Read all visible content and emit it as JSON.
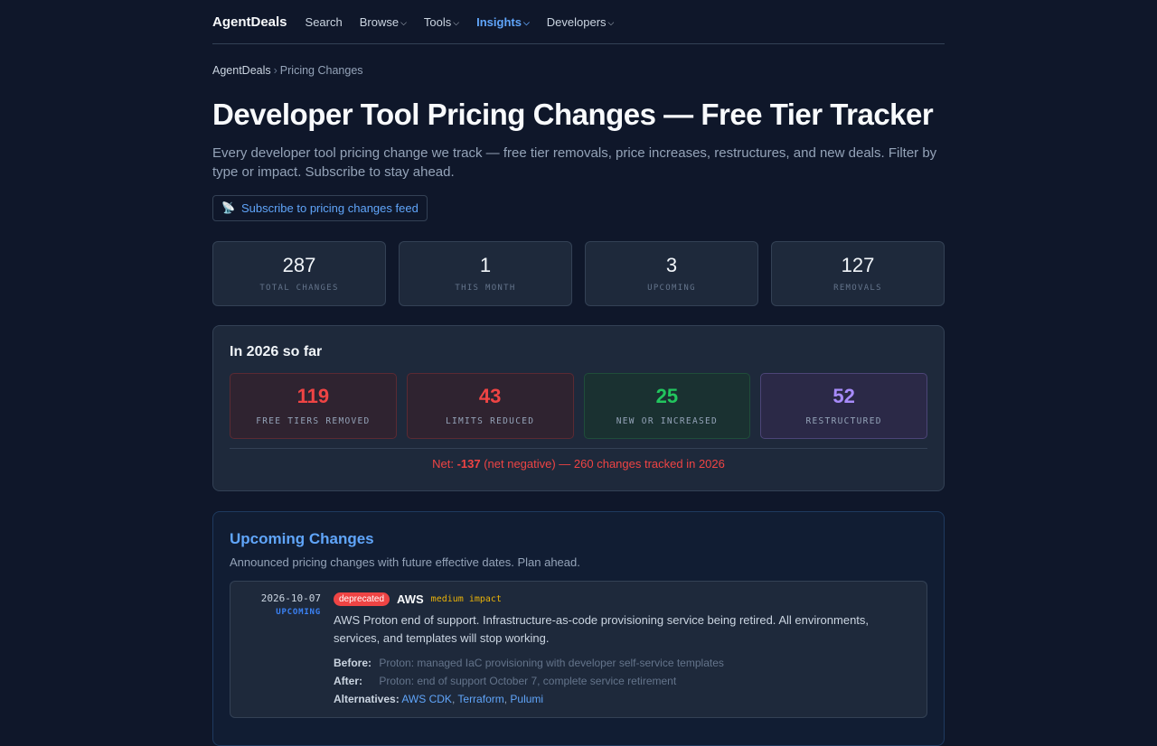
{
  "nav": {
    "brand": "AgentDeals",
    "items": [
      {
        "label": "Search",
        "dropdown": false,
        "active": false
      },
      {
        "label": "Browse",
        "dropdown": true,
        "active": false
      },
      {
        "label": "Tools",
        "dropdown": true,
        "active": false
      },
      {
        "label": "Insights",
        "dropdown": true,
        "active": true
      },
      {
        "label": "Developers",
        "dropdown": true,
        "active": false
      }
    ]
  },
  "breadcrumb": {
    "home": "AgentDeals",
    "separator": "›",
    "current": "Pricing Changes"
  },
  "page": {
    "title": "Developer Tool Pricing Changes — Free Tier Tracker",
    "description": "Every developer tool pricing change we track — free tier removals, price increases, restructures, and new deals. Filter by type or impact. Subscribe to stay ahead.",
    "subscribe_icon": "📡",
    "subscribe_label": "Subscribe to pricing changes feed"
  },
  "stats": [
    {
      "value": "287",
      "label": "TOTAL CHANGES"
    },
    {
      "value": "1",
      "label": "THIS MONTH"
    },
    {
      "value": "3",
      "label": "UPCOMING"
    },
    {
      "value": "127",
      "label": "REMOVALS"
    }
  ],
  "year_summary": {
    "title": "In 2026 so far",
    "cards": [
      {
        "value": "119",
        "label": "FREE TIERS REMOVED",
        "tone": "red"
      },
      {
        "value": "43",
        "label": "LIMITS REDUCED",
        "tone": "red"
      },
      {
        "value": "25",
        "label": "NEW OR INCREASED",
        "tone": "green"
      },
      {
        "value": "52",
        "label": "RESTRUCTURED",
        "tone": "purple"
      }
    ],
    "net_prefix": "Net: ",
    "net_value": "-137",
    "net_suffix": " (net negative) — 260 changes tracked in 2026"
  },
  "upcoming": {
    "title": "Upcoming Changes",
    "subtitle": "Announced pricing changes with future effective dates. Plan ahead.",
    "entries": [
      {
        "date": "2026-10-07",
        "status": "UPCOMING",
        "badge": "deprecated",
        "vendor": "AWS",
        "impact": "medium impact",
        "text": "AWS Proton end of support. Infrastructure-as-code provisioning service being retired. All environments, services, and templates will stop working.",
        "before_label": "Before:",
        "before": "Proton: managed IaC provisioning with developer self-service templates",
        "after_label": "After:",
        "after": "Proton: end of support October 7, complete service retirement",
        "alternatives_label": "Alternatives:",
        "alternatives": [
          "AWS CDK",
          "Terraform",
          "Pulumi"
        ]
      }
    ]
  },
  "colors": {
    "background": "#0f172a",
    "card": "#1e293b",
    "accent": "#60a5fa",
    "danger": "#ef4444",
    "success": "#22c55e",
    "purple": "#a78bfa",
    "warning": "#eab308"
  }
}
